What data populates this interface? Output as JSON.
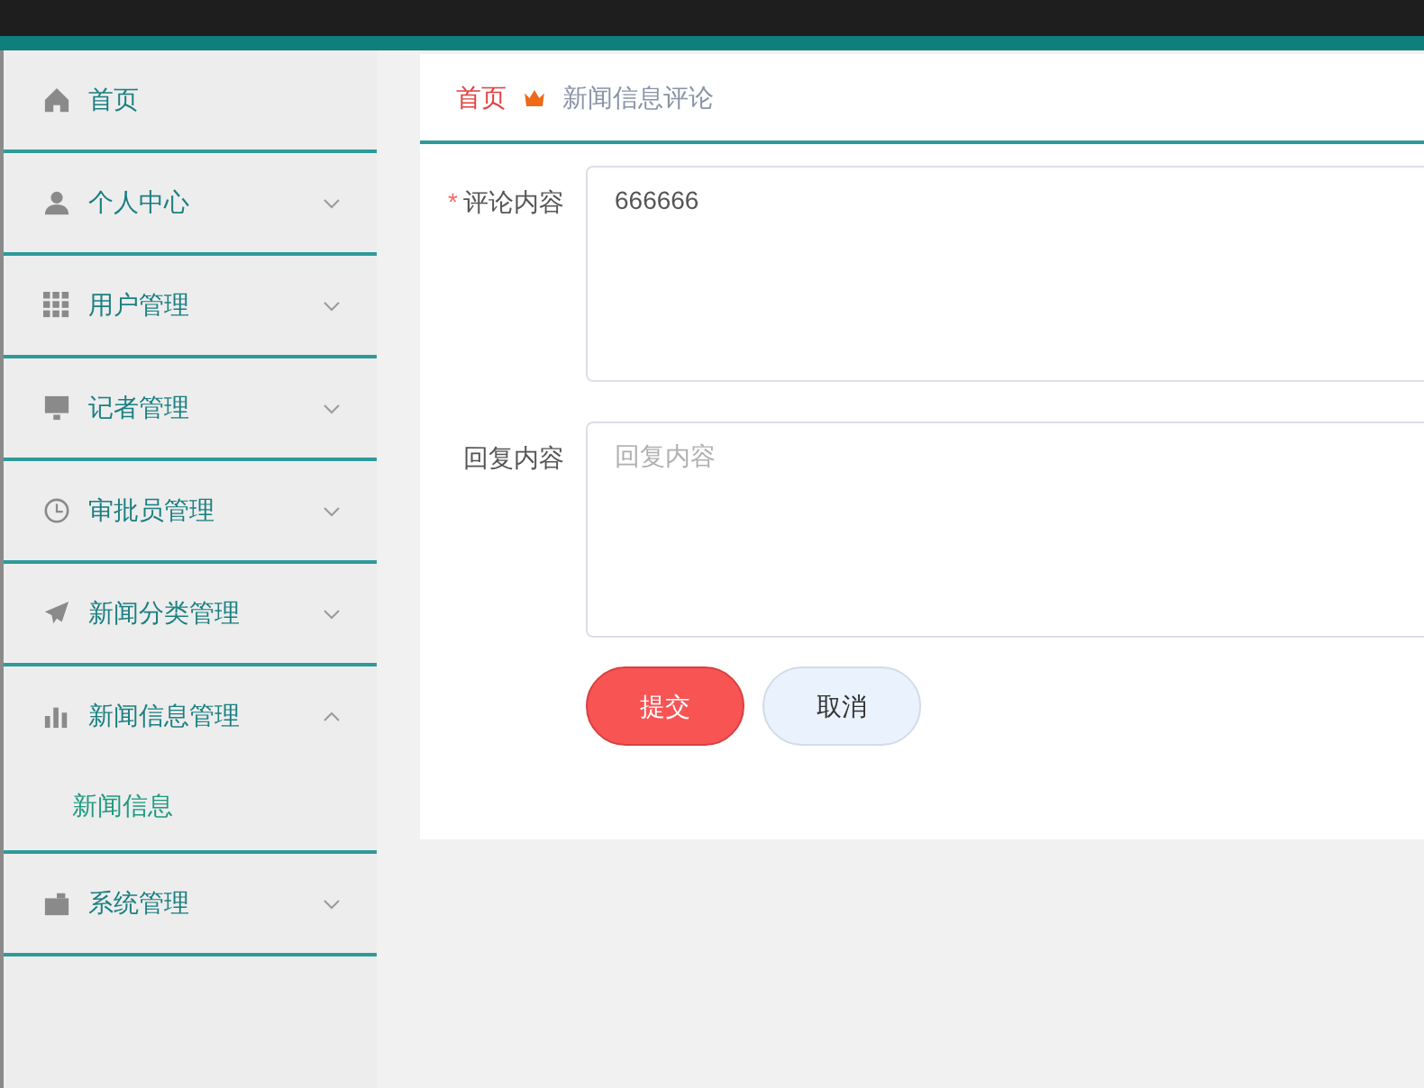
{
  "sidebar": {
    "items": [
      {
        "label": "首页",
        "kind": "link"
      },
      {
        "label": "个人中心",
        "kind": "submenu",
        "expanded": false
      },
      {
        "label": "用户管理",
        "kind": "submenu",
        "expanded": false
      },
      {
        "label": "记者管理",
        "kind": "submenu",
        "expanded": false
      },
      {
        "label": "审批员管理",
        "kind": "submenu",
        "expanded": false
      },
      {
        "label": "新闻分类管理",
        "kind": "submenu",
        "expanded": false
      },
      {
        "label": "新闻信息管理",
        "kind": "submenu",
        "expanded": true,
        "children": [
          {
            "label": "新闻信息"
          }
        ]
      },
      {
        "label": "系统管理",
        "kind": "submenu",
        "expanded": false
      }
    ]
  },
  "breadcrumb": {
    "home": "首页",
    "current": "新闻信息评论"
  },
  "form": {
    "fields": [
      {
        "label": "评论内容",
        "required_mark": "*",
        "value": "666666"
      },
      {
        "label": "回复内容",
        "placeholder": "回复内容"
      }
    ],
    "buttons": [
      {
        "label": "提交",
        "kind": "primary"
      },
      {
        "label": "取消",
        "kind": "secondary"
      }
    ]
  }
}
